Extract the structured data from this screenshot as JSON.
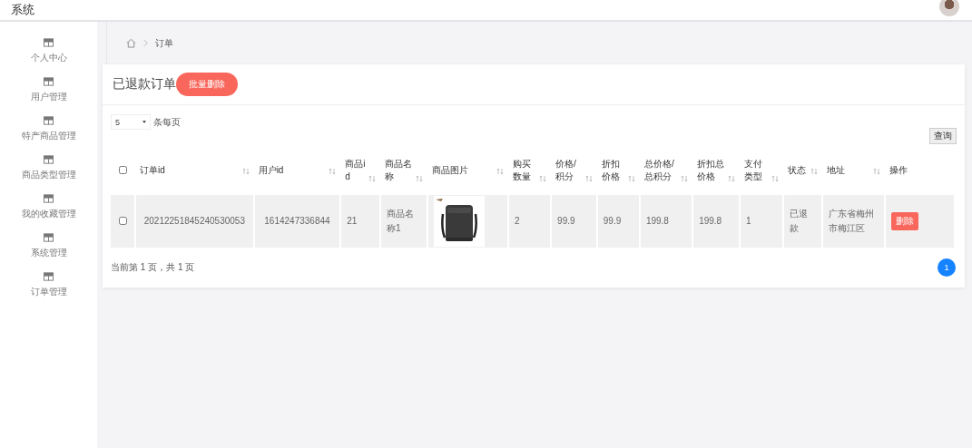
{
  "header": {
    "title": "系统"
  },
  "sidebar": {
    "items": [
      {
        "label": "个人中心"
      },
      {
        "label": "用户管理"
      },
      {
        "label": "特产商品管理"
      },
      {
        "label": "商品类型管理"
      },
      {
        "label": "我的收藏管理"
      },
      {
        "label": "系统管理"
      },
      {
        "label": "订单管理"
      }
    ]
  },
  "breadcrumb": {
    "current": "订单"
  },
  "page": {
    "title": "已退款订单",
    "batch_delete": "批量删除"
  },
  "page_size": {
    "value": "5",
    "label": "条每页"
  },
  "search_button": "查询",
  "table": {
    "select_all": {
      "checked": false
    },
    "columns": [
      {
        "label": "订单id",
        "sortable": true
      },
      {
        "label": "用户id",
        "sortable": true
      },
      {
        "label": "商品id",
        "sortable": true
      },
      {
        "label": "商品名称",
        "sortable": true
      },
      {
        "label": "商品图片",
        "sortable": true
      },
      {
        "label": "购买数量",
        "sortable": true
      },
      {
        "label": "价格/积分",
        "sortable": true
      },
      {
        "label": "折扣价格",
        "sortable": true
      },
      {
        "label": "总价格/总积分",
        "sortable": true
      },
      {
        "label": "折扣总价格",
        "sortable": true
      },
      {
        "label": "支付类型",
        "sortable": true
      },
      {
        "label": "状态",
        "sortable": true
      },
      {
        "label": "地址",
        "sortable": true
      },
      {
        "label": "操作",
        "sortable": false
      }
    ],
    "rows": [
      {
        "checked": false,
        "cells": [
          {
            "kind": "text",
            "text": "20212251845240530053"
          },
          {
            "kind": "text",
            "text": "1614247336844"
          },
          {
            "kind": "text",
            "text": "21"
          },
          {
            "kind": "text",
            "text": "商品名称1"
          },
          {
            "kind": "picture"
          },
          {
            "kind": "text",
            "text": "2"
          },
          {
            "kind": "text",
            "text": "99.9"
          },
          {
            "kind": "text",
            "text": "99.9"
          },
          {
            "kind": "text",
            "text": "199.8"
          },
          {
            "kind": "text",
            "text": "199.8"
          },
          {
            "kind": "text",
            "text": "1"
          },
          {
            "kind": "text",
            "text": "已退款"
          },
          {
            "kind": "text",
            "text": "广东省梅州市梅江区"
          },
          {
            "kind": "button",
            "label": "删除"
          }
        ]
      }
    ]
  },
  "footer": {
    "page_info": "当前第 1 页，共 1 页"
  },
  "pagination": [
    {
      "label": "1",
      "selected": true
    }
  ]
}
